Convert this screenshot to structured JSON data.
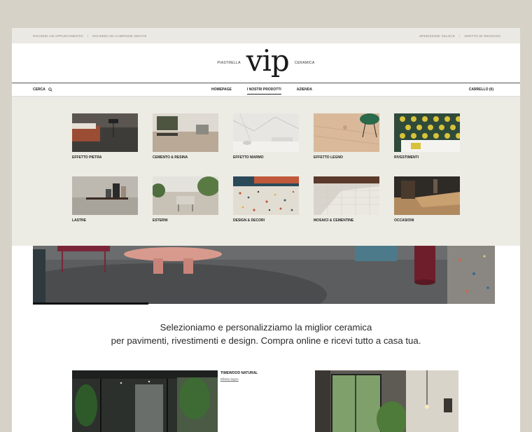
{
  "topbar": {
    "left": [
      "RICHIEDI UN APPUNTAMENTO",
      "RICHIEDI UN CAMPIONE GRATIS"
    ],
    "right": [
      "SPEDIZIONE VELOCE",
      "DIRITTO DI RECESSO"
    ],
    "separator": "|"
  },
  "logo": {
    "left": "PIASTRELLA",
    "main": "vip",
    "right": "CERAMICA"
  },
  "nav": {
    "search": "CERCA",
    "items": [
      "HOMEPAGE",
      "I NOSTRI PRODOTTI",
      "AZIENDA"
    ],
    "cart": "CARRELLO (0)"
  },
  "categories": [
    {
      "label": "Effetto PIETRA",
      "icon": "stone-interior-thumb"
    },
    {
      "label": "CEMENTO & RESINA",
      "icon": "concrete-interior-thumb"
    },
    {
      "label": "Effetto MARMO",
      "icon": "marble-bathroom-thumb"
    },
    {
      "label": "Effetto LEGNO",
      "icon": "wood-floor-thumb"
    },
    {
      "label": "RIVESTIMENTI",
      "icon": "patterned-tile-thumb"
    },
    {
      "label": "LASTRE",
      "icon": "slab-wall-thumb"
    },
    {
      "label": "ESTERNI",
      "icon": "outdoor-terrace-thumb"
    },
    {
      "label": "DESIGN & DECORI",
      "icon": "terrazzo-thumb"
    },
    {
      "label": "MOSAICI & CEMENTINE",
      "icon": "mosaic-thumb"
    },
    {
      "label": "OCCASIONI",
      "icon": "offers-thumb"
    }
  ],
  "tagline": {
    "line1": "Selezioniamo e personalizziamo la miglior ceramica",
    "line2": "per pavimenti, rivestimenti e design. Compra online e ricevi tutto a casa tua."
  },
  "product": {
    "title": "TIMEWOOD NATURAL",
    "subtitle": "Effetto legno"
  },
  "colors": {
    "page_bg": "#d6d2c8",
    "menu_bg": "#ecebe4",
    "text": "#222222"
  }
}
